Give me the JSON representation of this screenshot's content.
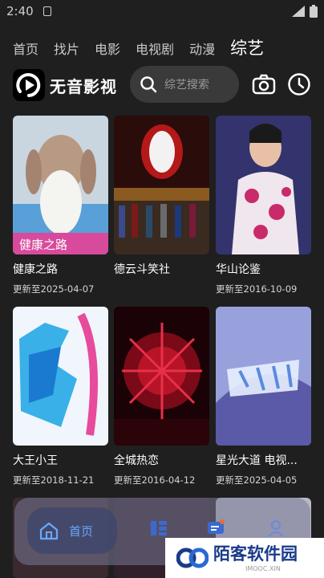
{
  "status_bar": {
    "time": "2:40"
  },
  "tabs": [
    {
      "label": "首页"
    },
    {
      "label": "找片"
    },
    {
      "label": "电影"
    },
    {
      "label": "电视剧"
    },
    {
      "label": "动漫"
    },
    {
      "label": "综艺"
    }
  ],
  "header": {
    "title": "无音影视",
    "search_placeholder": "综艺搜索"
  },
  "cards": [
    {
      "title": "健康之路",
      "date": "更新至2025-04-07"
    },
    {
      "title": "德云斗笑社",
      "date": ""
    },
    {
      "title": "华山论鉴",
      "date": "更新至2016-10-09"
    },
    {
      "title": "大王小王",
      "date": "更新至2018-11-21"
    },
    {
      "title": "全城热恋",
      "date": "更新至2016-04-12"
    },
    {
      "title": "星光大道 电视...",
      "date": "更新至2025-04-05"
    }
  ],
  "bottom_nav": {
    "home_label": "首页"
  },
  "watermark": {
    "text": "陌客软件园",
    "sub": "IMOOC.XIN"
  },
  "colors": {
    "accent": "#6aa8ff",
    "background": "#1f1f1f"
  }
}
